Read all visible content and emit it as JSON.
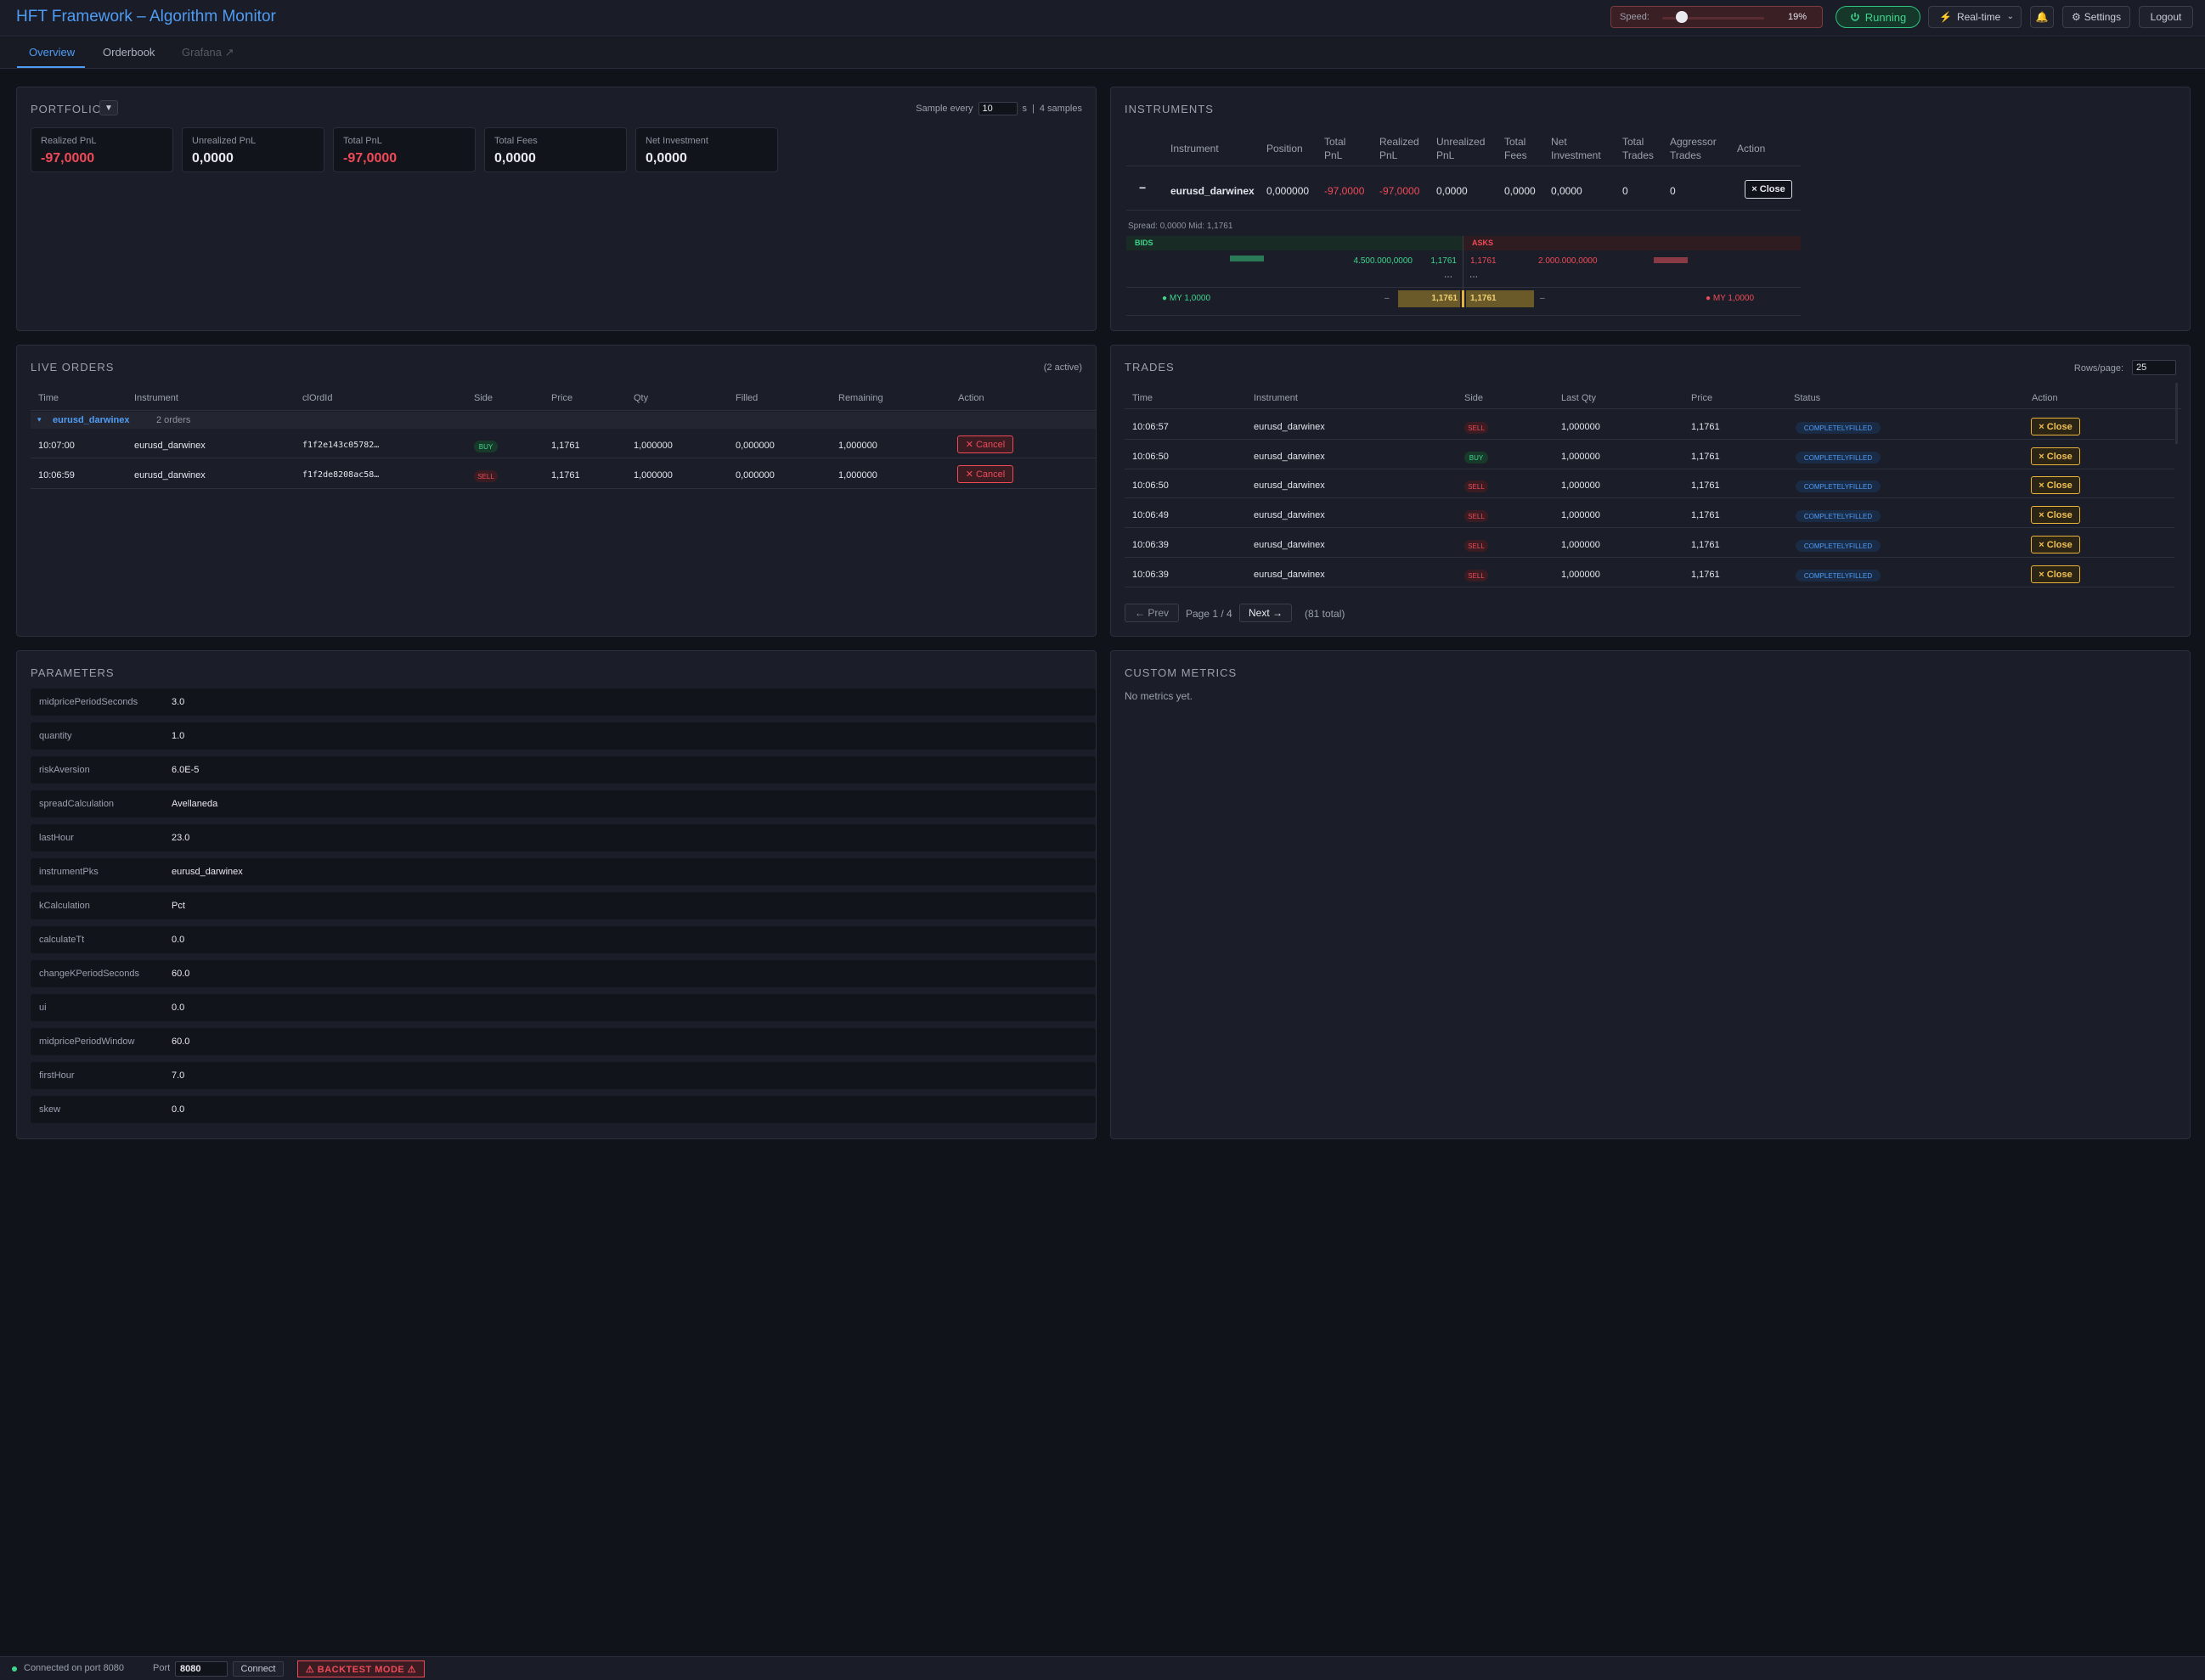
{
  "header": {
    "title": "HFT Framework – Algorithm Monitor",
    "speed_label": "Speed:",
    "speed_value": "19%",
    "speed_fraction": 0.19,
    "running_label": "Running",
    "mode_label": "Real-time",
    "settings_label": "Settings",
    "logout_label": "Logout"
  },
  "tabs": [
    {
      "label": "Overview"
    },
    {
      "label": "Orderbook"
    },
    {
      "label": "Grafana ↗"
    }
  ],
  "portfolio": {
    "title": "PORTFOLIO",
    "toggle": "▼",
    "sample_label": "Sample every",
    "sample_value": "10",
    "sample_unit": "s",
    "sep": "|",
    "samples_count": "4 samples",
    "cards": [
      {
        "label": "Realized PnL",
        "value": "-97,0000"
      },
      {
        "label": "Unrealized PnL",
        "value": "0,0000"
      },
      {
        "label": "Total PnL",
        "value": "-97,0000"
      },
      {
        "label": "Total Fees",
        "value": "0,0000"
      },
      {
        "label": "Net Investment",
        "value": "0,0000"
      }
    ]
  },
  "instruments": {
    "title": "INSTRUMENTS",
    "headers": {
      "instrument": "Instrument",
      "position": "Position",
      "total_pnl_1": "Total",
      "total_pnl_2": "PnL",
      "realized_1": "Realized",
      "realized_2": "PnL",
      "unrealized_1": "Unrealized",
      "unrealized_2": "PnL",
      "fees_1": "Total",
      "fees_2": "Fees",
      "net_1": "Net",
      "net_2": "Investment",
      "trades_1": "Total",
      "trades_2": "Trades",
      "aggr_1": "Aggressor",
      "aggr_2": "Trades",
      "action": "Action"
    },
    "row": {
      "collapse": "−",
      "instrument": "eurusd_darwinex",
      "position": "0,000000",
      "total_pnl": "-97,0000",
      "realized": "-97,0000",
      "unrealized": "0,0000",
      "fees": "0,0000",
      "net": "0,0000",
      "trades": "0",
      "aggressor": "0",
      "close_label": "× Close"
    },
    "orderbook": {
      "spread_text": "Spread: 0,0000   Mid: 1,1761",
      "bids_label": "BIDS",
      "asks_label": "ASKS",
      "bid_qty": "4.500.000,0000",
      "bid_price": "1,1761",
      "ask_price": "1,1761",
      "ask_qty": "2.000.000,0000",
      "ellipsis": "⋯",
      "my_bid": "● MY 1,0000",
      "my_bid_dash": "–",
      "my_bid_price": "1,1761",
      "my_ask_price": "1,1761",
      "my_ask_dash": "–",
      "my_ask": "● MY 1,0000"
    }
  },
  "live_orders": {
    "title": "LIVE ORDERS",
    "active": "(2 active)",
    "headers": [
      "Time",
      "Instrument",
      "clOrdId",
      "Side",
      "Price",
      "Qty",
      "Filled",
      "Remaining",
      "Action"
    ],
    "group_toggle": "▾",
    "group_name": "eurusd_darwinex",
    "group_count": "2 orders",
    "rows": [
      {
        "time": "10:07:00",
        "instrument": "eurusd_darwinex",
        "clordid": "f1f2e143c05782…",
        "side": "BUY",
        "price": "1,1761",
        "qty": "1,000000",
        "filled": "0,000000",
        "remaining": "1,000000",
        "action": "Cancel"
      },
      {
        "time": "10:06:59",
        "instrument": "eurusd_darwinex",
        "clordid": "f1f2de8208ac58…",
        "side": "SELL",
        "price": "1,1761",
        "qty": "1,000000",
        "filled": "0,000000",
        "remaining": "1,000000",
        "action": "Cancel"
      }
    ]
  },
  "trades": {
    "title": "TRADES",
    "rows_per_page_label": "Rows/page:",
    "rows_per_page": "25",
    "headers": [
      "Time",
      "Instrument",
      "Side",
      "Last Qty",
      "Price",
      "Status",
      "Action"
    ],
    "rows": [
      {
        "time": "10:06:57",
        "instrument": "eurusd_darwinex",
        "side": "SELL",
        "qty": "1,000000",
        "price": "1,1761",
        "status": "COMPLETELYFILLED",
        "action": "× Close"
      },
      {
        "time": "10:06:50",
        "instrument": "eurusd_darwinex",
        "side": "BUY",
        "qty": "1,000000",
        "price": "1,1761",
        "status": "COMPLETELYFILLED",
        "action": "× Close"
      },
      {
        "time": "10:06:50",
        "instrument": "eurusd_darwinex",
        "side": "SELL",
        "qty": "1,000000",
        "price": "1,1761",
        "status": "COMPLETELYFILLED",
        "action": "× Close"
      },
      {
        "time": "10:06:49",
        "instrument": "eurusd_darwinex",
        "side": "SELL",
        "qty": "1,000000",
        "price": "1,1761",
        "status": "COMPLETELYFILLED",
        "action": "× Close"
      },
      {
        "time": "10:06:39",
        "instrument": "eurusd_darwinex",
        "side": "SELL",
        "qty": "1,000000",
        "price": "1,1761",
        "status": "COMPLETELYFILLED",
        "action": "× Close"
      },
      {
        "time": "10:06:39",
        "instrument": "eurusd_darwinex",
        "side": "SELL",
        "qty": "1,000000",
        "price": "1,1761",
        "status": "COMPLETELYFILLED",
        "action": "× Close"
      }
    ],
    "prev_label": "← Prev",
    "page_text": "Page 1 / 4",
    "next_label": "Next →",
    "total_text": "(81 total)"
  },
  "parameters": {
    "title": "PARAMETERS",
    "rows": [
      {
        "key": "midpricePeriodSeconds",
        "value": "3.0"
      },
      {
        "key": "quantity",
        "value": "1.0"
      },
      {
        "key": "riskAversion",
        "value": "6.0E-5"
      },
      {
        "key": "spreadCalculation",
        "value": "Avellaneda"
      },
      {
        "key": "lastHour",
        "value": "23.0"
      },
      {
        "key": "instrumentPks",
        "value": "eurusd_darwinex"
      },
      {
        "key": "kCalculation",
        "value": "Pct"
      },
      {
        "key": "calculateTt",
        "value": "0.0"
      },
      {
        "key": "changeKPeriodSeconds",
        "value": "60.0"
      },
      {
        "key": "ui",
        "value": "0.0"
      },
      {
        "key": "midpricePeriodWindow",
        "value": "60.0"
      },
      {
        "key": "firstHour",
        "value": "7.0"
      },
      {
        "key": "skew",
        "value": "0.0"
      }
    ]
  },
  "custom_metrics": {
    "title": "CUSTOM METRICS",
    "empty_text": "No metrics yet."
  },
  "footer": {
    "status_text": "Connected on port 8080",
    "port_label": "Port",
    "port_value": "8080",
    "connect_label": "Connect",
    "backtest_label": "⚠ BACKTEST MODE ⚠"
  },
  "colors": {
    "accent": "#4f9cf5",
    "positive": "#3ed68c",
    "negative": "#f04a58",
    "warning": "#f0c050"
  }
}
